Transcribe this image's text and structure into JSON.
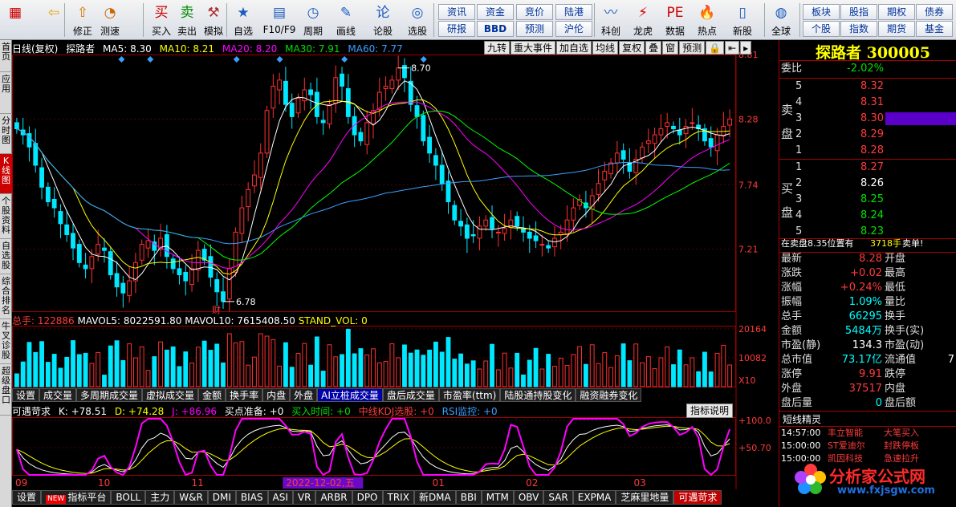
{
  "toolbar": {
    "buttons": [
      {
        "label": "",
        "icon": "app-icon"
      },
      {
        "label": "",
        "icon": "back-icon"
      },
      {
        "label": "修正",
        "icon": "fix-icon"
      },
      {
        "label": "测速",
        "icon": "speed-icon"
      },
      {
        "label": "买入",
        "icon": "buy-icon"
      },
      {
        "label": "卖出",
        "icon": "sell-icon"
      },
      {
        "label": "模拟",
        "icon": "simulate-icon"
      },
      {
        "label": "自选",
        "icon": "favorite-icon"
      },
      {
        "label": "F10/F9",
        "icon": "f10-icon"
      },
      {
        "label": "周期",
        "icon": "period-icon"
      },
      {
        "label": "画线",
        "icon": "draw-icon"
      },
      {
        "label": "论股",
        "icon": "discuss-icon"
      },
      {
        "label": "选股",
        "icon": "select-icon"
      },
      {
        "label": "科创",
        "icon": "star-market-icon"
      },
      {
        "label": "龙虎",
        "icon": "dragon-tiger-icon"
      },
      {
        "label": "数据",
        "icon": "data-icon"
      },
      {
        "label": "热点",
        "icon": "hotspot-icon"
      },
      {
        "label": "新股",
        "icon": "ipo-icon"
      },
      {
        "label": "全球",
        "icon": "globe-icon"
      }
    ],
    "small_buttons": [
      "资讯",
      "资金",
      "竞价",
      "陆港",
      "研报",
      "BBD",
      "预测",
      "沪伦",
      "板块",
      "股指",
      "期权",
      "债券",
      "个股",
      "指数",
      "期货",
      "基金"
    ]
  },
  "left_tabs": [
    "首页",
    "应用",
    "分时图",
    "K线图",
    "个股资料",
    "自选股",
    "综合排名",
    "牛叉诊股",
    "超级盘口"
  ],
  "info_bar": {
    "period": "日线(复权)",
    "stock": "探路者",
    "ma5": "MA5: 8.30",
    "ma10": "MA10: 8.21",
    "ma20": "MA20: 8.20",
    "ma30": "MA30: 7.91",
    "ma60": "MA60: 7.77"
  },
  "chart_tools": [
    "九转",
    "重大事件",
    "加自选",
    "均线",
    "复权",
    "叠",
    "窗",
    "预测"
  ],
  "chart_data": [
    {
      "type": "candlestick",
      "title": "探路者 300005 日线(复权)",
      "x_months": [
        "09",
        "10",
        "11",
        "12",
        "01",
        "02",
        "03"
      ],
      "cursor_date": "2022-12-02,五",
      "ylim": [
        6.7,
        8.81
      ],
      "price_ticks": [
        "8.81",
        "8.28",
        "7.74",
        "7.21"
      ],
      "annotations": {
        "high": "8.70",
        "low": "6.78",
        "low_marker": "财"
      },
      "moving_averages": [
        {
          "name": "MA5",
          "value": 8.3,
          "color": "#ffffff"
        },
        {
          "name": "MA10",
          "value": 8.21,
          "color": "#ffff00"
        },
        {
          "name": "MA20",
          "value": 8.2,
          "color": "#ff00ff"
        },
        {
          "name": "MA30",
          "value": 7.91,
          "color": "#00ff00"
        },
        {
          "name": "MA60",
          "value": 7.77,
          "color": "#3aa0ff"
        }
      ],
      "closes": [
        8.2,
        8.15,
        8.05,
        7.9,
        7.72,
        7.6,
        7.55,
        7.42,
        7.33,
        7.22,
        7.1,
        7.05,
        7.15,
        7.25,
        7.2,
        7.0,
        6.9,
        6.85,
        6.95,
        7.1,
        7.25,
        7.28,
        7.2,
        7.3,
        7.15,
        7.05,
        7.0,
        6.95,
        7.05,
        7.2,
        7.12,
        6.98,
        6.86,
        6.78,
        7.05,
        7.35,
        7.55,
        7.7,
        7.82,
        8.0,
        8.35,
        8.55,
        8.6,
        8.4,
        8.3,
        8.45,
        8.52,
        8.48,
        8.3,
        8.25,
        8.4,
        8.62,
        8.55,
        8.3,
        8.15,
        8.1,
        8.25,
        8.35,
        8.5,
        8.55,
        8.6,
        8.7,
        8.62,
        8.4,
        8.3,
        8.1,
        8.0,
        7.9,
        7.75,
        7.6,
        7.45,
        7.4,
        7.3,
        7.32,
        7.4,
        7.45,
        7.38,
        7.35,
        7.38,
        7.45,
        7.4,
        7.35,
        7.3,
        7.28,
        7.25,
        7.22,
        7.3,
        7.35,
        7.45,
        7.55,
        7.62,
        7.55,
        7.65,
        7.75,
        7.85,
        7.92,
        8.0,
        7.95,
        7.85,
        7.95,
        8.05,
        8.1,
        8.15,
        8.2,
        8.25,
        8.2,
        8.15,
        8.22,
        8.25,
        8.2,
        8.1,
        8.05,
        8.15,
        8.22,
        8.28
      ]
    },
    {
      "type": "bar",
      "title": "总手",
      "values_label": "总手: 122886",
      "mavol5": "MAVOL5: 8022591.80",
      "mavol10": "MAVOL10: 7615408.50",
      "stand_vol": "STAND_VOL: 0",
      "ticks": [
        "20164",
        "10082"
      ],
      "unit": "X10"
    },
    {
      "type": "line",
      "title": "可遇苛求",
      "k": "K: +78.51",
      "d": "D: +74.28",
      "j": "J: +86.96",
      "buy_ready": "买点准备: +0",
      "buy_time": "买入时间: +0",
      "kdj_pick": "中线KDJ选股: +0",
      "rsi": "RSI监控: +0",
      "ticks": [
        "+100.0",
        "+50.70"
      ]
    }
  ],
  "volume_tabs": [
    "设置",
    "成交量",
    "多周期成交量",
    "虚拟成交量",
    "金额",
    "换手率",
    "内盘",
    "外盘",
    "AI立桩成交量",
    "盘后成交量",
    "市盈率(ttm)",
    "陆股通持股变化",
    "融资融券变化"
  ],
  "indicator_button": "指标说明",
  "bottom_tabs": [
    "设置",
    "指标平台",
    "BOLL",
    "主力",
    "W&R",
    "DMI",
    "BIAS",
    "ASI",
    "VR",
    "ARBR",
    "DPO",
    "TRIX",
    "新DMA",
    "BBI",
    "MTM",
    "OBV",
    "SAR",
    "EXPMA",
    "芝麻里地量",
    "可遇苛求"
  ],
  "right_panel": {
    "title": "探路者 300005",
    "wei_bi_label": "委比",
    "wei_bi": "-2.02%",
    "sell_label": "卖盘",
    "buy_label": "买盘",
    "sell": [
      {
        "level": "5",
        "price": "8.32"
      },
      {
        "level": "4",
        "price": "8.31"
      },
      {
        "level": "3",
        "price": "8.30"
      },
      {
        "level": "2",
        "price": "8.29"
      },
      {
        "level": "1",
        "price": "8.28"
      }
    ],
    "buy": [
      {
        "level": "1",
        "price": "8.27"
      },
      {
        "level": "2",
        "price": "8.26"
      },
      {
        "level": "3",
        "price": "8.25"
      },
      {
        "level": "4",
        "price": "8.24"
      },
      {
        "level": "5",
        "price": "8.23"
      }
    ],
    "sell_note": "在卖盘8.35位置有",
    "sell_note_qty": "3718手",
    "sell_note_tag": "卖单!",
    "stats": [
      {
        "l": "最新",
        "v": "8.28",
        "c": "red",
        "l2": "开盘",
        "v2": ""
      },
      {
        "l": "涨跌",
        "v": "+0.02",
        "c": "red",
        "l2": "最高",
        "v2": ""
      },
      {
        "l": "涨幅",
        "v": "+0.24%",
        "c": "red",
        "l2": "最低",
        "v2": ""
      },
      {
        "l": "振幅",
        "v": "1.09%",
        "c": "cyan",
        "l2": "量比",
        "v2": ""
      },
      {
        "l": "总手",
        "v": "66295",
        "c": "cyan",
        "l2": "换手",
        "v2": ""
      },
      {
        "l": "金额",
        "v": "5484万",
        "c": "cyan",
        "l2": "换手(实)",
        "v2": ""
      },
      {
        "l": "市盈(静)",
        "v": "134.3",
        "c": "white",
        "l2": "市盈(动)",
        "v2": ""
      },
      {
        "l": "总市值",
        "v": "73.17亿",
        "c": "cyan",
        "l2": "流通值",
        "v2": "7"
      },
      {
        "l": "涨停",
        "v": "9.91",
        "c": "red",
        "l2": "跌停",
        "v2": ""
      },
      {
        "l": "外盘",
        "v": "37517",
        "c": "red",
        "l2": "内盘",
        "v2": ""
      },
      {
        "l": "盘后量",
        "v": "0",
        "c": "cyan",
        "l2": "盘后额",
        "v2": ""
      }
    ],
    "short_line_title": "短线精灵",
    "elves": [
      {
        "time": "14:57:00",
        "name": "丰立智能",
        "event": "大笔买入"
      },
      {
        "time": "15:00:00",
        "name": "ST爱迪尔",
        "event": "封跌停板"
      },
      {
        "time": "15:00:00",
        "name": "凯因科技",
        "event": "急速拉升"
      }
    ]
  },
  "watermark": {
    "line1": "分析家公式网",
    "line2": "www.fxjsgw.com"
  }
}
